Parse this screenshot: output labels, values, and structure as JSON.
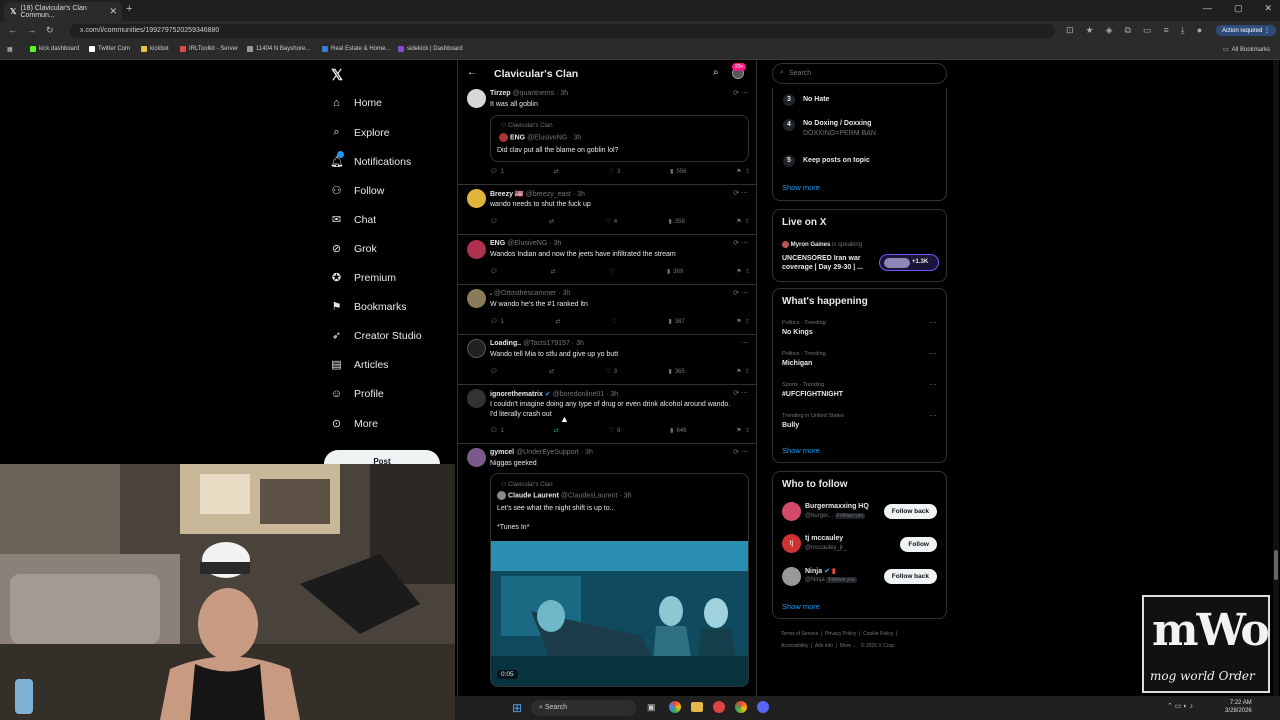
{
  "browser": {
    "tab_title": "(18) Clavicular's Clan Commun...",
    "url": "x.com/i/communities/1992797520259346880",
    "action_required": "Action required",
    "bookmarks": [
      "kick dashboard",
      "Twitter Com",
      "kickbot",
      "IRLToolkit - Server",
      "11404 N Bayshore...",
      "Real Estate & Home...",
      "sidekick | Dashboard"
    ],
    "all_bookmarks": "All Bookmarks"
  },
  "nav": {
    "items": [
      "Home",
      "Explore",
      "Notifications",
      "Follow",
      "Chat",
      "Grok",
      "Premium",
      "Bookmarks",
      "Creator Studio",
      "Articles",
      "Profile",
      "More"
    ],
    "post_label": "Post",
    "notif_badge": "20+"
  },
  "feed": {
    "title": "Clavicular's Clan",
    "tweets": [
      {
        "name": "Tirzep",
        "handle": "@quantnems · 3h",
        "text": "It was all goblin",
        "quote_community": "Clavicular's Clan",
        "quote_name": "ENG",
        "quote_handle": "@ElusiveNG · 3h",
        "quote_text": "Did clav put all the blame on goblin lol?",
        "replies": "1",
        "likes": "3",
        "views": "556"
      },
      {
        "name": "Breezy",
        "handle": "@breezy_east · 3h",
        "text": "wando needs to shut the fuck up",
        "replies": "",
        "likes": "4",
        "views": "358"
      },
      {
        "name": "ENG",
        "handle": "@ElusiveNG · 3h",
        "text": "Wandos Indian and now the jeets have infiltrated the stream",
        "replies": "",
        "likes": "",
        "views": "369"
      },
      {
        "name": ".",
        "handle": "@Ottosthescammer · 3h",
        "text": "W wando he's the #1 ranked ltn",
        "replies": "1",
        "likes": "",
        "views": "387"
      },
      {
        "name": "Loading..",
        "handle": "@Tacts179157 · 3h",
        "text": "Wando tell Mia to stfu and give up yo butt",
        "replies": "",
        "likes": "3",
        "views": "365"
      },
      {
        "name": "ignorethematrix",
        "handle": "@boredonline01 · 3h",
        "text": "I couldn't imagine doing any type of drug or even drink alcohol around wando. I'd literally crash out",
        "replies": "1",
        "likes": "8",
        "views": "646"
      },
      {
        "name": "gymcel",
        "handle": "@UnderEyeSupport · 3h",
        "text": "Niggas geeked",
        "quote_community": "Clavicular's Clan",
        "quote_name": "Claude Laurent",
        "quote_handle": "@ClaudesLaurent · 3h",
        "quote_text": "Let's see what the night shift is up to..",
        "quote_text2": "*Tunes In*",
        "video_time": "0:05"
      }
    ]
  },
  "right": {
    "search_placeholder": "Search",
    "rules": [
      {
        "num": "3",
        "title": "No Hate",
        "sub": ""
      },
      {
        "num": "4",
        "title": "No Doxing / Doxxing",
        "sub": "DOXXING=PERM BAN"
      },
      {
        "num": "5",
        "title": "Keep posts on topic",
        "sub": ""
      }
    ],
    "show_more": "Show more",
    "live_title": "Live on X",
    "live_host": "Myron Gaines",
    "live_host_status": "is speaking",
    "live_text": "UNCENSORED Iran war coverage | Day 29-30 | ...",
    "live_count": "+1.3K",
    "happening_title": "What's happening",
    "trends": [
      {
        "cat": "Politics · Trending",
        "name": "No Kings"
      },
      {
        "cat": "Politics · Trending",
        "name": "Michigan"
      },
      {
        "cat": "Sports · Trending",
        "name": "#UFCFIGHTNIGHT"
      },
      {
        "cat": "Trending in United States",
        "name": "Bully"
      }
    ],
    "wtf_title": "Who to follow",
    "follows": [
      {
        "name": "Burgermaxxing HQ",
        "handle": "@burger...",
        "badge": "Follows you",
        "btn": "Follow back"
      },
      {
        "name": "tj mccauley",
        "handle": "@mccauley_jr_",
        "badge": "",
        "btn": "Follow"
      },
      {
        "name": "Ninja",
        "handle": "@Ninja",
        "badge": "Follows you",
        "btn": "Follow back"
      }
    ],
    "footer": [
      "Terms of Service",
      "Privacy Policy",
      "Cookie Policy",
      "Accessibility",
      "Ads info",
      "More ...",
      "© 2026 X Corp."
    ]
  },
  "taskbar": {
    "search": "Search",
    "time": "7:22 AM",
    "date": "3/28/2026"
  },
  "overlay": {
    "logo_text": "mWo",
    "logo_sub": "mog world Order"
  }
}
